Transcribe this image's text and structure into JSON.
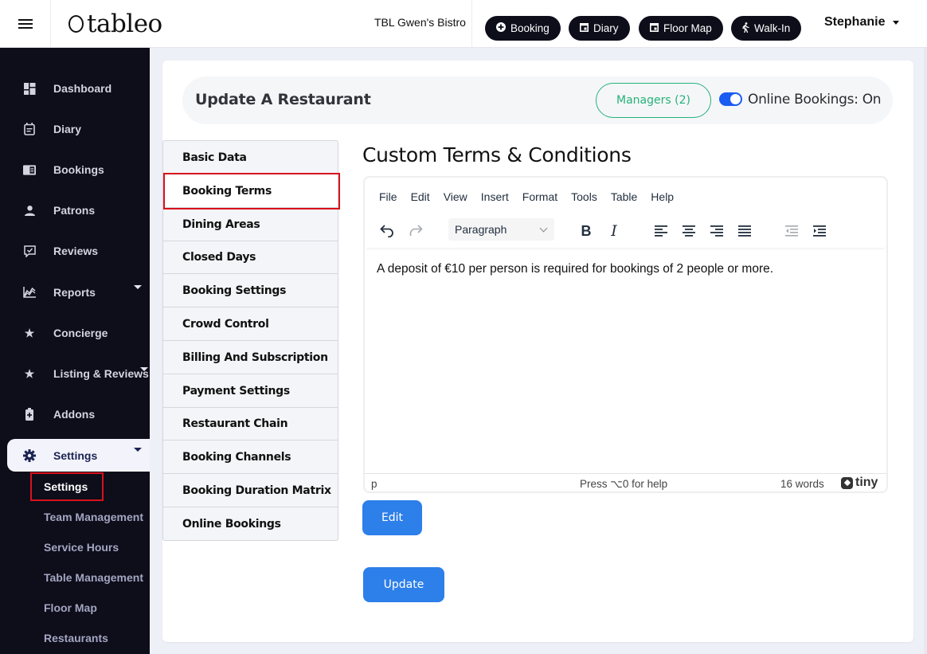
{
  "header": {
    "brand": "tableo",
    "restaurant_name": "TBL Gwen's Bistro",
    "actions": [
      {
        "label": "Booking",
        "icon": "plus-circle-icon"
      },
      {
        "label": "Diary",
        "icon": "calendar-icon"
      },
      {
        "label": "Floor Map",
        "icon": "calendar-icon"
      },
      {
        "label": "Walk-In",
        "icon": "walking-icon"
      }
    ],
    "user_name": "Stephanie"
  },
  "sidebar": {
    "items": [
      {
        "label": "Dashboard",
        "icon": "dashboard-icon"
      },
      {
        "label": "Diary",
        "icon": "calendar-icon"
      },
      {
        "label": "Bookings",
        "icon": "book-icon"
      },
      {
        "label": "Patrons",
        "icon": "person-icon"
      },
      {
        "label": "Reviews",
        "icon": "review-icon"
      },
      {
        "label": "Reports",
        "icon": "chart-icon",
        "expandable": true
      },
      {
        "label": "Concierge",
        "icon": "star-icon"
      },
      {
        "label": "Listing & Reviews",
        "icon": "star-icon",
        "expandable": true
      },
      {
        "label": "Addons",
        "icon": "battery-plus-icon"
      },
      {
        "label": "Settings",
        "icon": "gear-icon",
        "expandable": true,
        "active": true
      }
    ],
    "sub_items": [
      {
        "label": "Settings",
        "current": true
      },
      {
        "label": "Team Management"
      },
      {
        "label": "Service Hours"
      },
      {
        "label": "Table Management"
      },
      {
        "label": "Floor Map"
      },
      {
        "label": "Restaurants"
      }
    ]
  },
  "page": {
    "title": "Update A Restaurant",
    "managers_label": "Managers (2)",
    "online_bookings_label": "Online Bookings: On",
    "online_bookings_on": true
  },
  "tabs": [
    {
      "label": "Basic Data"
    },
    {
      "label": "Booking Terms",
      "active": true
    },
    {
      "label": "Dining Areas"
    },
    {
      "label": "Closed Days"
    },
    {
      "label": "Booking Settings"
    },
    {
      "label": "Crowd Control"
    },
    {
      "label": "Billing And Subscription"
    },
    {
      "label": "Payment Settings"
    },
    {
      "label": "Restaurant Chain"
    },
    {
      "label": "Booking Channels"
    },
    {
      "label": "Booking Duration Matrix"
    },
    {
      "label": "Online Bookings"
    }
  ],
  "content": {
    "section_title": "Custom Terms & Conditions",
    "editor": {
      "menu": [
        "File",
        "Edit",
        "View",
        "Insert",
        "Format",
        "Tools",
        "Table",
        "Help"
      ],
      "block_format": "Paragraph",
      "body_text": "A deposit of €10 per person is required for bookings of 2 people or more.",
      "status_path": "p",
      "status_help": "Press ⌥0 for help",
      "word_count": "16 words",
      "brand": "tiny"
    },
    "edit_label": "Edit",
    "update_label": "Update"
  },
  "colors": {
    "sidebar_bg": "#0e0d1a",
    "primary_button": "#2d7fe9",
    "managers_green": "#25b27a",
    "toggle_blue": "#1a5cf2",
    "highlight_red": "#d8121c"
  }
}
